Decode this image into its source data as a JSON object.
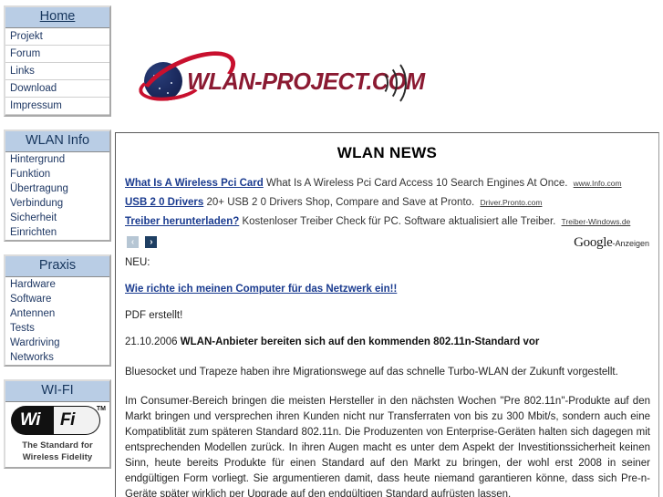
{
  "site": {
    "logo_wordmark": "WLAN-PROJECT.COM"
  },
  "sidebar": {
    "boxes": [
      {
        "head": "Home",
        "head_is_link": true,
        "items": [
          {
            "label": "Projekt"
          },
          {
            "label": "Forum"
          },
          {
            "label": "Links"
          },
          {
            "label": "Download"
          },
          {
            "label": "Impressum"
          }
        ]
      },
      {
        "head": "WLAN Info",
        "head_is_link": false,
        "items": [
          {
            "label": "Hintergrund"
          },
          {
            "label": "Funktion"
          },
          {
            "label": "Übertragung"
          },
          {
            "label": "Verbindung"
          },
          {
            "label": "Sicherheit"
          },
          {
            "label": "Einrichten"
          }
        ]
      },
      {
        "head": "Praxis",
        "head_is_link": false,
        "items": [
          {
            "label": "Hardware"
          },
          {
            "label": "Software"
          },
          {
            "label": "Antennen"
          },
          {
            "label": "Tests"
          },
          {
            "label": "Wardriving"
          },
          {
            "label": "Networks"
          }
        ]
      }
    ],
    "wifi_box": {
      "head": "WI-FI",
      "logo_wi": "Wi",
      "logo_fi": "Fi",
      "trademark": "TM",
      "tagline_line1": "The Standard for",
      "tagline_line2": "Wireless Fidelity"
    }
  },
  "main": {
    "title": "WLAN NEWS",
    "ads": [
      {
        "title": "What Is A Wireless Pci Card",
        "desc": "What Is A Wireless Pci Card Access 10 Search Engines At Once.",
        "url": "www.Info.com"
      },
      {
        "title": "USB 2 0 Drivers",
        "desc": "20+ USB 2 0 Drivers Shop, Compare and Save at Pronto.",
        "url": "Driver.Pronto.com"
      },
      {
        "title": "Treiber herunterladen?",
        "desc": "Kostenloser Treiber Check für PC. Software aktualisiert alle Treiber.",
        "url": "Treiber-Windows.de"
      }
    ],
    "ad_nav": {
      "prev_glyph": "‹",
      "next_glyph": "›"
    },
    "ad_brand": {
      "google": "Google",
      "suffix": "-Anzeigen"
    },
    "news": {
      "new_label": "NEU:",
      "featured_link": "Wie richte ich meinen Computer für das Netzwerk ein!!",
      "pdf_note": "PDF erstellt!",
      "date": "21.10.2006",
      "headline": "WLAN-Anbieter bereiten sich auf den kommenden 802.11n-Standard vor",
      "para1": "Bluesocket und Trapeze haben ihre Migrationswege auf das schnelle Turbo-WLAN der Zukunft vorgestellt.",
      "para2": "Im Consumer-Bereich bringen die meisten Hersteller in den nächsten Wochen \"Pre 802.11n\"-Produkte auf den Markt bringen und versprechen ihren Kunden nicht nur Transferraten von bis zu 300 Mbit/s, sondern auch eine Kompatiblität zum späteren Standard 802.11n. Die Produzenten von Enterprise-Geräten halten sich dagegen mit entsprechenden Modellen zurück. In ihren Augen macht es unter dem Aspekt der Investitionssicherheit keinen Sinn, heute bereits Produkte für einen Standard auf den Markt zu bringen, der wohl erst 2008 in seiner endgültigen Form vorliegt. Sie argumentieren damit, dass heute niemand garantieren könne, dass sich Pre-n-Geräte später wirklich per Upgrade auf den endgültigen Standard aufrüsten lassen."
    }
  },
  "colors": {
    "nav_head_bg": "#b9cde5",
    "link_blue": "#1a3b8f",
    "logo_red": "#8b1a32",
    "swoosh_red": "#c8102e",
    "sphere_navy": "#1b2a5e"
  }
}
